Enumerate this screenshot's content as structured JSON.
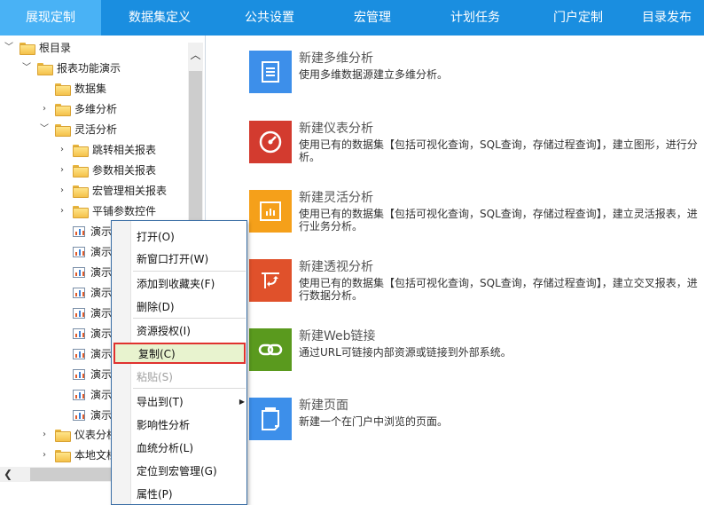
{
  "nav": {
    "tabs": [
      {
        "label": "展现定制",
        "active": true
      },
      {
        "label": "数据集定义"
      },
      {
        "label": "公共设置"
      },
      {
        "label": "宏管理"
      },
      {
        "label": "计划任务"
      },
      {
        "label": "门户定制"
      },
      {
        "label": "目录发布"
      }
    ]
  },
  "tree": {
    "items": [
      {
        "label": "根目录",
        "arrow": "expanded",
        "icon": "folder-icon"
      },
      {
        "label": "报表功能演示",
        "arrow": "expanded",
        "icon": "folder-icon"
      },
      {
        "label": "数据集",
        "arrow": "none",
        "icon": "folder-icon"
      },
      {
        "label": "多维分析",
        "arrow": "collapsed",
        "icon": "folder-icon"
      },
      {
        "label": "灵活分析",
        "arrow": "expanded",
        "icon": "folder-icon"
      },
      {
        "label": "跳转相关报表",
        "arrow": "collapsed",
        "icon": "folder-icon"
      },
      {
        "label": "参数相关报表",
        "arrow": "collapsed",
        "icon": "folder-icon"
      },
      {
        "label": "宏管理相关报表",
        "arrow": "collapsed",
        "icon": "folder-icon"
      },
      {
        "label": "平铺参数控件",
        "arrow": "collapsed",
        "icon": "folder-icon"
      },
      {
        "label": "演示",
        "arrow": "none",
        "icon": "report-icon"
      },
      {
        "label": "演示",
        "arrow": "none",
        "icon": "report-icon"
      },
      {
        "label": "演示",
        "arrow": "none",
        "icon": "report-icon"
      },
      {
        "label": "演示",
        "arrow": "none",
        "icon": "report-icon"
      },
      {
        "label": "演示",
        "arrow": "none",
        "icon": "report-icon"
      },
      {
        "label": "演示",
        "arrow": "none",
        "icon": "report-icon"
      },
      {
        "label": "演示",
        "arrow": "none",
        "icon": "report-icon"
      },
      {
        "label": "演示",
        "arrow": "none",
        "icon": "report-icon"
      },
      {
        "label": "演示",
        "arrow": "none",
        "icon": "report-icon"
      },
      {
        "label": "演示",
        "arrow": "none",
        "icon": "report-icon"
      },
      {
        "label": "仪表分析",
        "arrow": "collapsed",
        "icon": "folder-icon"
      },
      {
        "label": "本地文档",
        "arrow": "collapsed",
        "icon": "folder-icon"
      }
    ]
  },
  "context_menu": {
    "items": [
      {
        "label": "打开(O)"
      },
      {
        "label": "新窗口打开(W)"
      },
      {
        "label": "添加到收藏夹(F)"
      },
      {
        "label": "删除(D)"
      },
      {
        "label": "资源授权(I)"
      },
      {
        "label": "复制(C)",
        "highlighted": true
      },
      {
        "label": "粘贴(S)",
        "disabled": true
      },
      {
        "label": "导出到(T)",
        "submenu": true
      },
      {
        "label": "影响性分析"
      },
      {
        "label": "血统分析(L)"
      },
      {
        "label": "定位到宏管理(G)"
      },
      {
        "label": "属性(P)"
      }
    ]
  },
  "actions": [
    {
      "title": "新建多维分析",
      "desc": "使用多维数据源建立多维分析。",
      "color": "#3d8fea",
      "icon": "document-icon"
    },
    {
      "title": "新建仪表分析",
      "desc": "使用已有的数据集【包括可视化查询，SQL查询，存储过程查询】，建立图形，进行分析。",
      "color": "#d33b2f",
      "icon": "gauge-icon"
    },
    {
      "title": "新建灵活分析",
      "desc": "使用已有的数据集【包括可视化查询，SQL查询，存储过程查询】，建立灵活报表，进行业务分析。",
      "color": "#f5a01a",
      "icon": "chart-board-icon"
    },
    {
      "title": "新建透视分析",
      "desc": "使用已有的数据集【包括可视化查询，SQL查询，存储过程查询】，建立交叉报表，进行数据分析。",
      "color": "#e0512b",
      "icon": "pivot-icon"
    },
    {
      "title": "新建Web链接",
      "desc": "通过URL可链接内部资源或链接到外部系统。",
      "color": "#5a9a1e",
      "icon": "link-icon"
    },
    {
      "title": "新建页面",
      "desc": "新建一个在门户中浏览的页面。",
      "color": "#3d8fea",
      "icon": "page-icon"
    }
  ]
}
